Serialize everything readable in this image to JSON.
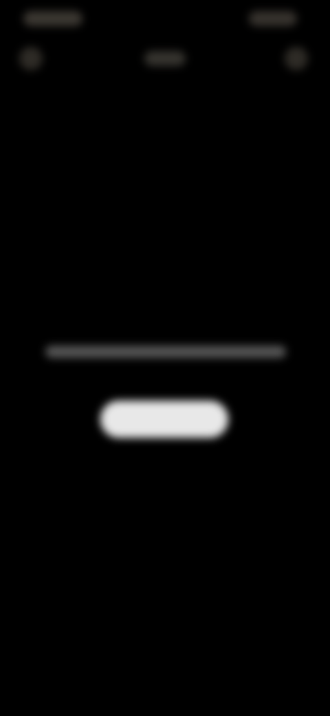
{
  "status_bar": {
    "time": "",
    "indicators": ""
  },
  "top_bar": {
    "title": ""
  },
  "message": {
    "text": ""
  },
  "action": {
    "button_label": ""
  },
  "colors": {
    "background": "#000000",
    "button": "#e8e8e8"
  },
  "icons": {
    "left": "close-icon",
    "right": "more-icon"
  }
}
